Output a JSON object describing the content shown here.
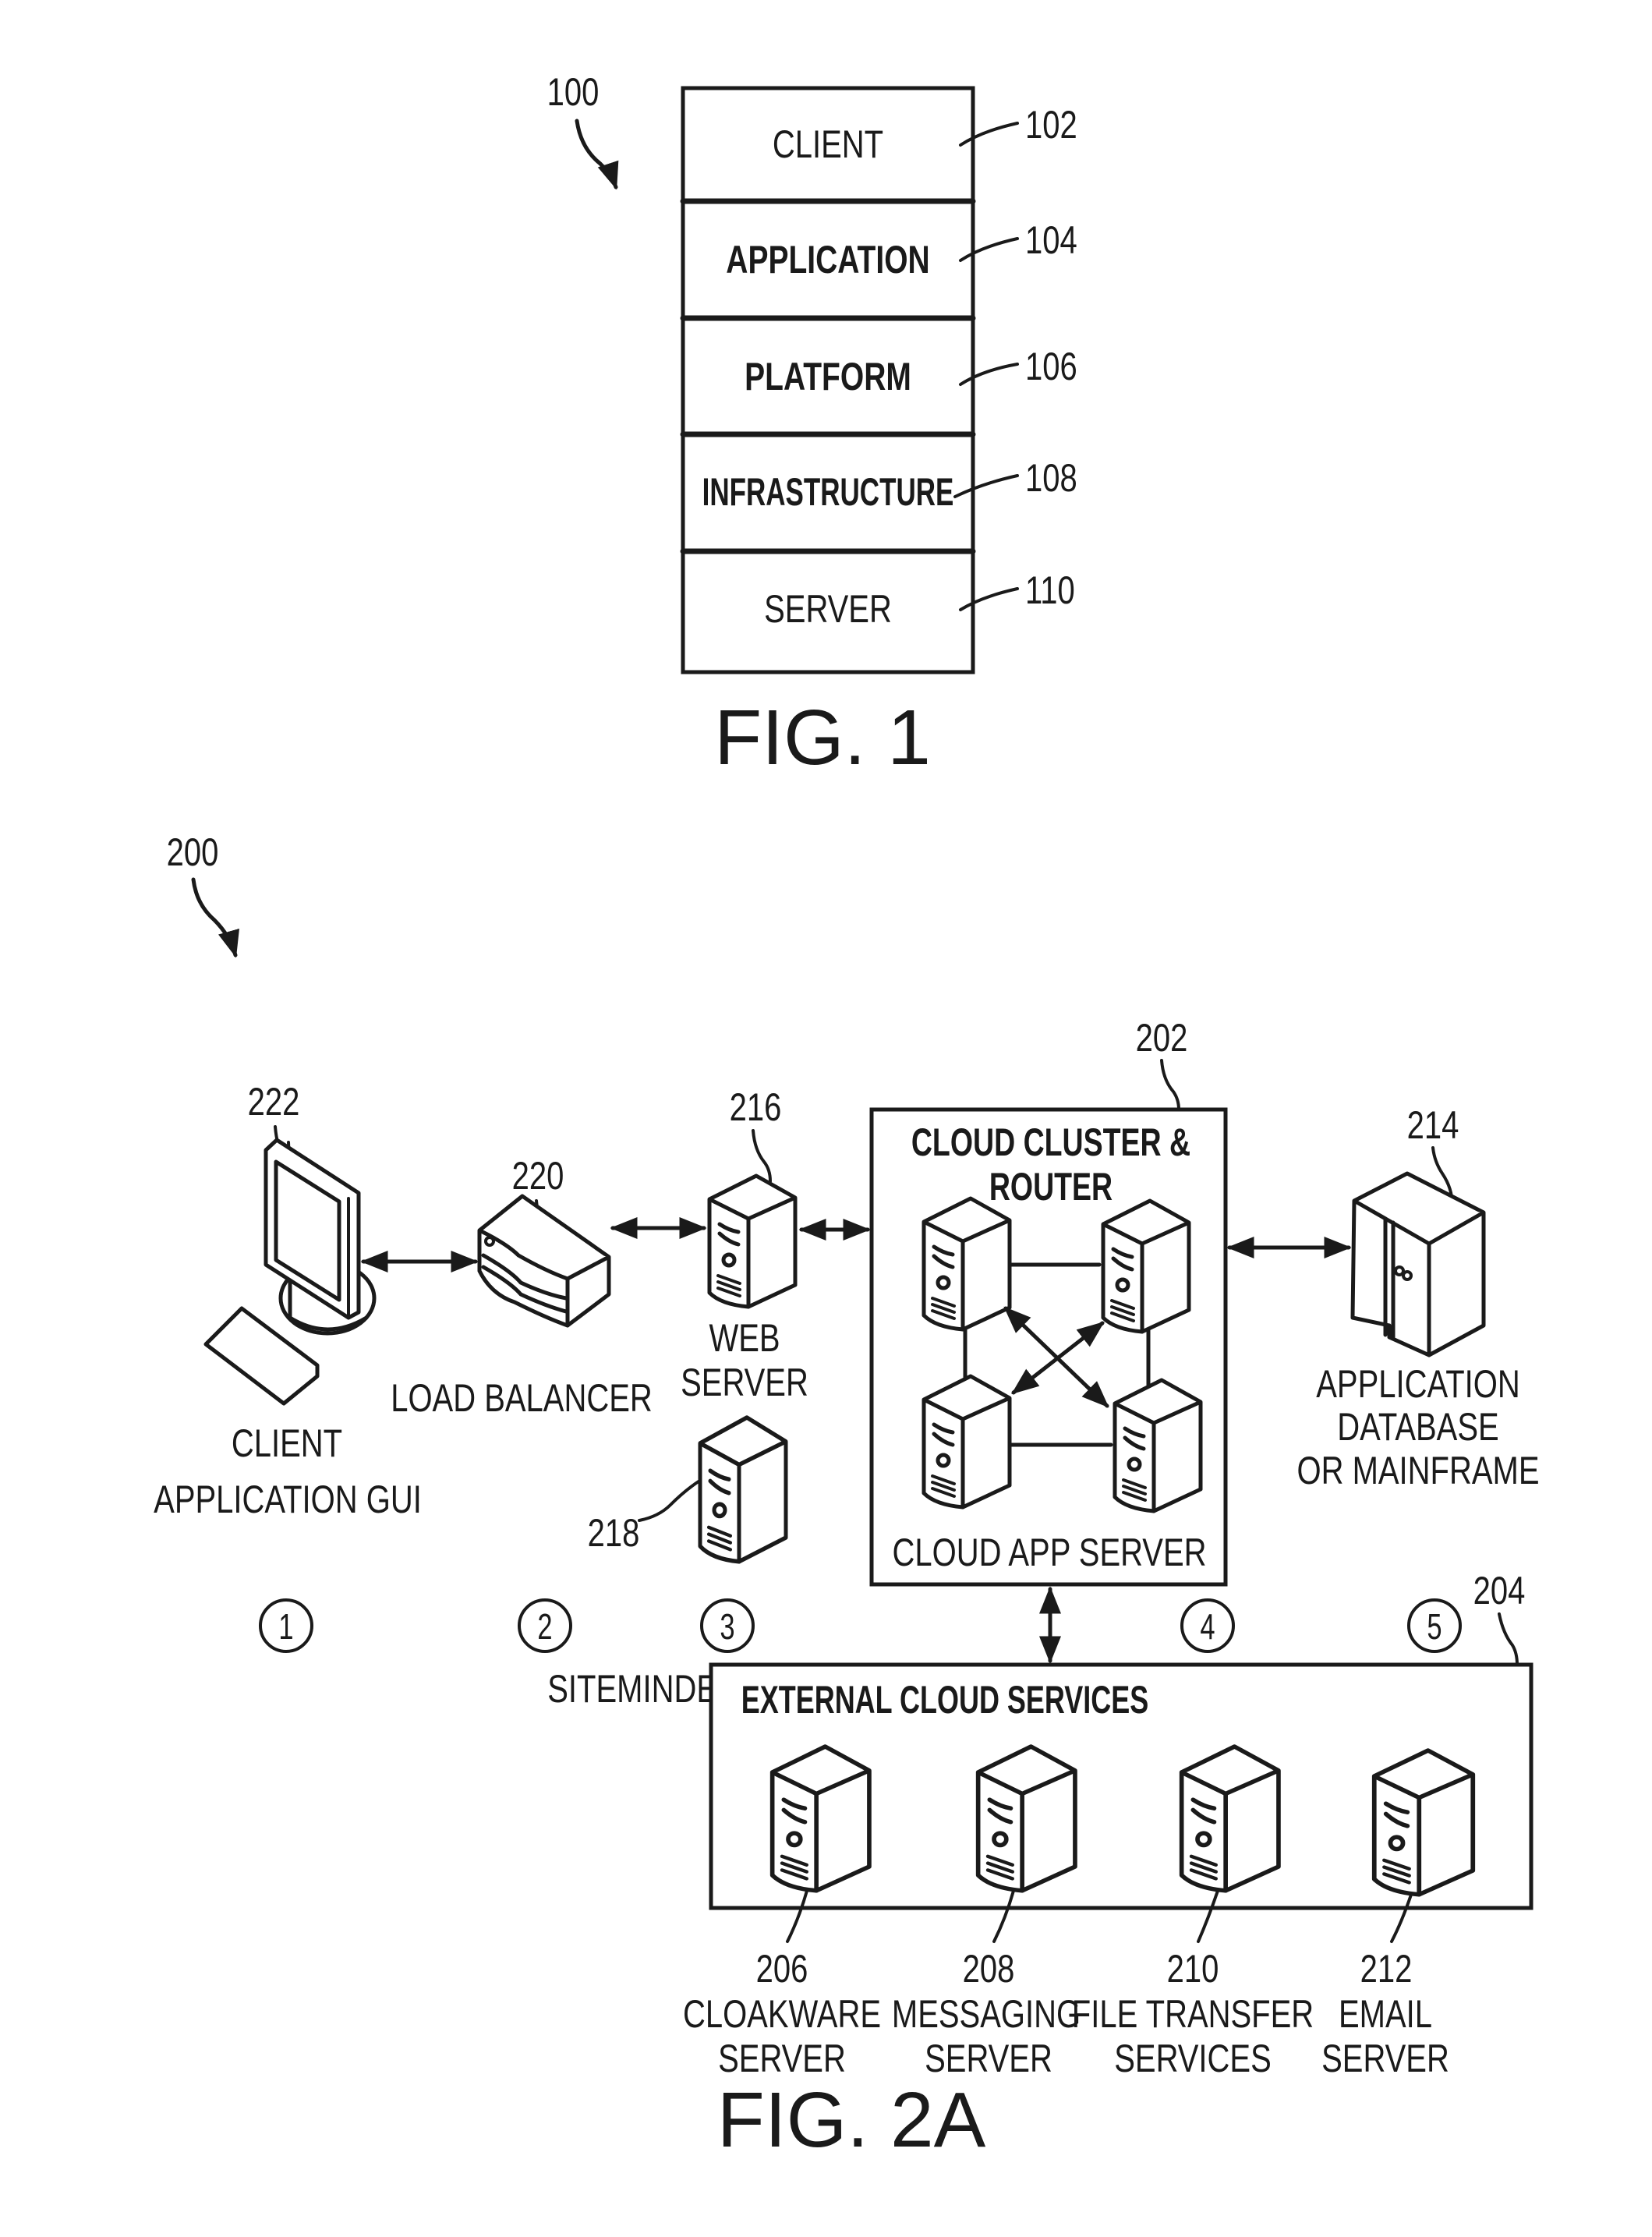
{
  "fig1": {
    "ref": "100",
    "caption": "FIG. 1",
    "layers": [
      {
        "label": "CLIENT",
        "ref": "102",
        "bold": false
      },
      {
        "label": "APPLICATION",
        "ref": "104",
        "bold": true
      },
      {
        "label": "PLATFORM",
        "ref": "106",
        "bold": true
      },
      {
        "label": "INFRASTRUCTURE",
        "ref": "108",
        "bold": true
      },
      {
        "label": "SERVER",
        "ref": "110",
        "bold": false
      }
    ]
  },
  "fig2a": {
    "ref": "200",
    "caption": "FIG. 2A",
    "client": {
      "ref": "222",
      "label_line1": "CLIENT",
      "label_line2": "APPLICATION GUI"
    },
    "load_balancer": {
      "ref": "220",
      "label": "LOAD BALANCER"
    },
    "web_server": {
      "ref": "216",
      "label_line1": "WEB",
      "label_line2": "SERVER"
    },
    "siteminder": {
      "ref": "218",
      "label": "SITEMINDER SERVER"
    },
    "cloud_cluster": {
      "ref": "202",
      "title_line1": "CLOUD CLUSTER &",
      "title_line2": "ROUTER",
      "footer": "CLOUD APP SERVER"
    },
    "app_database": {
      "ref": "214",
      "label_line1": "APPLICATION",
      "label_line2": "DATABASE",
      "label_line3": "OR MAINFRAME"
    },
    "steps": [
      "1",
      "2",
      "3",
      "4",
      "5"
    ],
    "external": {
      "ref": "204",
      "title": "EXTERNAL CLOUD SERVICES",
      "services": [
        {
          "ref": "206",
          "line1": "CLOAKWARE",
          "line2": "SERVER"
        },
        {
          "ref": "208",
          "line1": "MESSAGING",
          "line2": "SERVER"
        },
        {
          "ref": "210",
          "line1": "FILE TRANSFER",
          "line2": "SERVICES"
        },
        {
          "ref": "212",
          "line1": "EMAIL",
          "line2": "SERVER"
        }
      ]
    }
  }
}
